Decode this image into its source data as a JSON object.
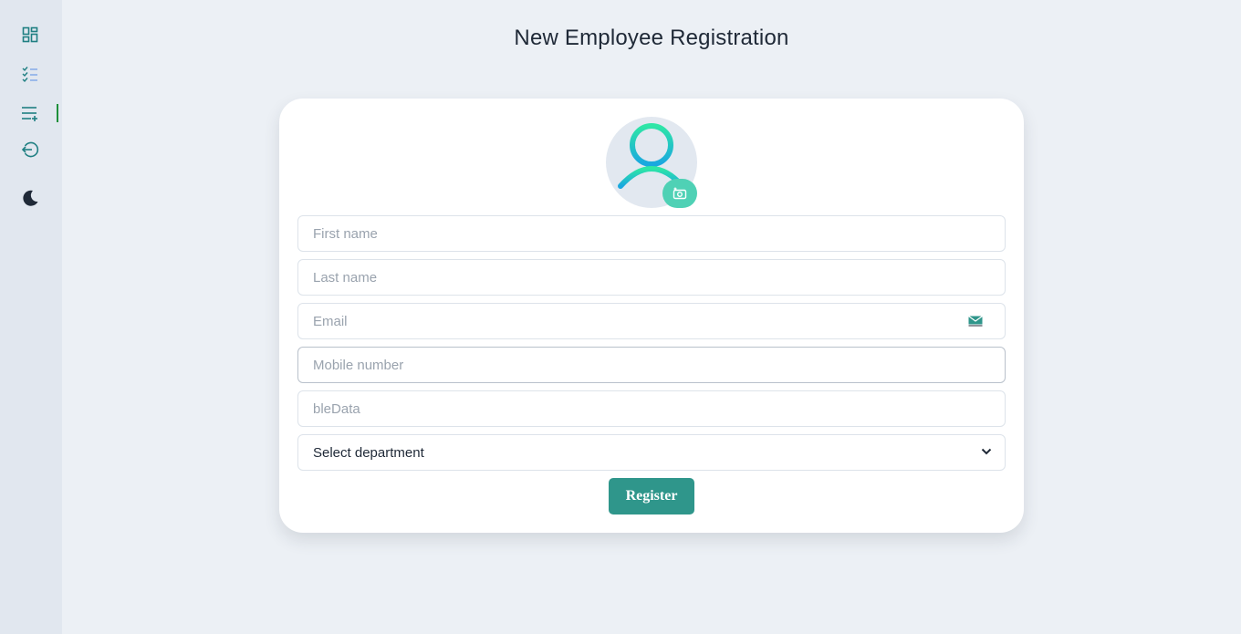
{
  "page": {
    "title": "New Employee Registration"
  },
  "sidebar": {
    "items": [
      {
        "icon": "dashboard-icon"
      },
      {
        "icon": "task-list-icon"
      },
      {
        "icon": "add-list-icon",
        "active": true
      },
      {
        "icon": "logout-icon"
      },
      {
        "icon": "dark-mode-moon-icon"
      }
    ],
    "accent": "#1d8f3a"
  },
  "form": {
    "avatar_icon": "user-icon",
    "camera_icon": "camera-icon",
    "first_name": {
      "value": "",
      "placeholder": "First name"
    },
    "last_name": {
      "value": "",
      "placeholder": "Last name"
    },
    "email": {
      "value": "",
      "placeholder": "Email",
      "icon": "mail-icon"
    },
    "mobile": {
      "value": "",
      "placeholder": "Mobile number"
    },
    "extra": {
      "value": "",
      "placeholder": "bleData"
    },
    "department": {
      "selected": "Select department"
    },
    "register_label": "Register"
  },
  "colors": {
    "primary": "#2f968b",
    "camera_badge": "#4fd1b5",
    "avatar_gradient_start": "#2ee6a6",
    "avatar_gradient_end": "#1aa7e0"
  }
}
